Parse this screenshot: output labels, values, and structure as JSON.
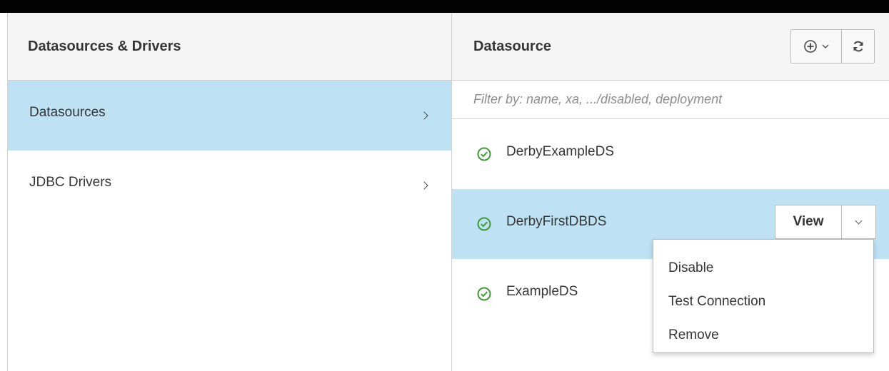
{
  "left_panel": {
    "title": "Datasources & Drivers",
    "items": [
      {
        "label": "Datasources",
        "active": true
      },
      {
        "label": "JDBC Drivers",
        "active": false
      }
    ]
  },
  "right_panel": {
    "title": "Datasource",
    "toolbar": {
      "add_icon": "add-circle-icon",
      "refresh_icon": "refresh-icon"
    },
    "filter": {
      "placeholder": "Filter by: name, xa, .../disabled, deployment",
      "value": ""
    },
    "datasources": [
      {
        "name": "DerbyExampleDS",
        "status": "ok",
        "active": false
      },
      {
        "name": "DerbyFirstDBDS",
        "status": "ok",
        "active": true
      },
      {
        "name": "ExampleDS",
        "status": "ok",
        "active": false
      }
    ],
    "item_actions": {
      "view_label": "View"
    },
    "dropdown_menu": [
      "Disable",
      "Test Connection",
      "Remove"
    ]
  },
  "colors": {
    "active_bg": "#bee1f4",
    "header_bg": "#f5f5f5",
    "status_ok": "#3f9c35",
    "top_bar": "#030303"
  }
}
